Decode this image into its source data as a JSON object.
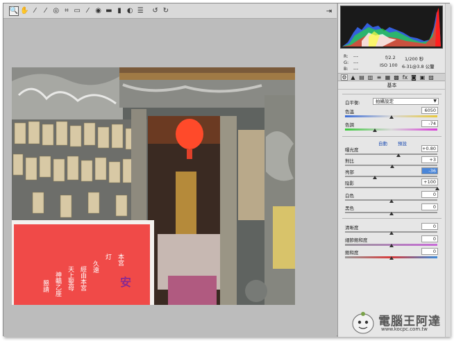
{
  "toolbar": {
    "tools": [
      {
        "name": "zoom-tool",
        "glyph": "🔍"
      },
      {
        "name": "hand-tool",
        "glyph": "✋"
      },
      {
        "name": "white-balance-tool",
        "glyph": "⁄"
      },
      {
        "name": "color-sampler-tool",
        "glyph": "⁄"
      },
      {
        "name": "targeted-adjustment-tool",
        "glyph": "◎"
      },
      {
        "name": "crop-tool",
        "glyph": "⌗"
      },
      {
        "name": "straighten-tool",
        "glyph": "▭"
      },
      {
        "name": "spot-removal-tool",
        "glyph": "⁄"
      },
      {
        "name": "red-eye-tool",
        "glyph": "◉"
      },
      {
        "name": "adjustment-brush-tool",
        "glyph": "▬"
      },
      {
        "name": "graduated-filter-tool",
        "glyph": "▮"
      },
      {
        "name": "radial-filter-tool",
        "glyph": "◐"
      },
      {
        "name": "preferences-tool",
        "glyph": "☰"
      },
      {
        "name": "rotate-left-tool",
        "glyph": "↺"
      },
      {
        "name": "rotate-right-tool",
        "glyph": "↻"
      }
    ],
    "open_glyph": "⇥"
  },
  "readout": {
    "r_label": "R:",
    "g_label": "G:",
    "b_label": "B:",
    "r_value": "---",
    "g_value": "---",
    "b_value": "---",
    "aperture": "f/2.2",
    "shutter": "1/200 秒",
    "iso": "ISO 100",
    "lens": "6-31@3.8 公釐"
  },
  "panel_tabs": [
    "⚙",
    "▲",
    "▤",
    "▥",
    "≡",
    "▦",
    "▩",
    "fx",
    "◙",
    "▣",
    "▨"
  ],
  "section_title": "基本",
  "white_balance": {
    "label": "白平衡:",
    "value": "拍攝設定"
  },
  "auto_link": "自動",
  "default_link": "預設",
  "sliders": [
    {
      "id": "temp",
      "label": "色溫",
      "value": "6050",
      "pos": 0.5
    },
    {
      "id": "tint",
      "label": "色調",
      "value": "-74",
      "pos": 0.32
    },
    {
      "id": "exposure",
      "label": "曝光度",
      "value": "+0.80",
      "pos": 0.58
    },
    {
      "id": "contrast",
      "label": "對比",
      "value": "+3",
      "pos": 0.51
    },
    {
      "id": "highlights",
      "label": "亮部",
      "value": "-36",
      "pos": 0.32,
      "selected": true
    },
    {
      "id": "shadows",
      "label": "陰影",
      "value": "+100",
      "pos": 1.0
    },
    {
      "id": "whites",
      "label": "白色",
      "value": "0",
      "pos": 0.5
    },
    {
      "id": "blacks",
      "label": "黑色",
      "value": "0",
      "pos": 0.5
    },
    {
      "id": "clarity",
      "label": "清晰度",
      "value": "0",
      "pos": 0.5
    },
    {
      "id": "vibrance",
      "label": "細節飽和度",
      "value": "0",
      "pos": 0.5
    },
    {
      "id": "saturation",
      "label": "飽和度",
      "value": "0",
      "pos": 0.5
    }
  ],
  "photo": {
    "sign_lines": [
      "本宮",
      "灯",
      "久遠",
      "經由本宮",
      "天上聖母",
      "神轎乙座",
      "懇請"
    ],
    "sign_right": "安"
  },
  "watermark": {
    "text": "電腦王阿達",
    "url": "www.kocpc.com.tw"
  }
}
